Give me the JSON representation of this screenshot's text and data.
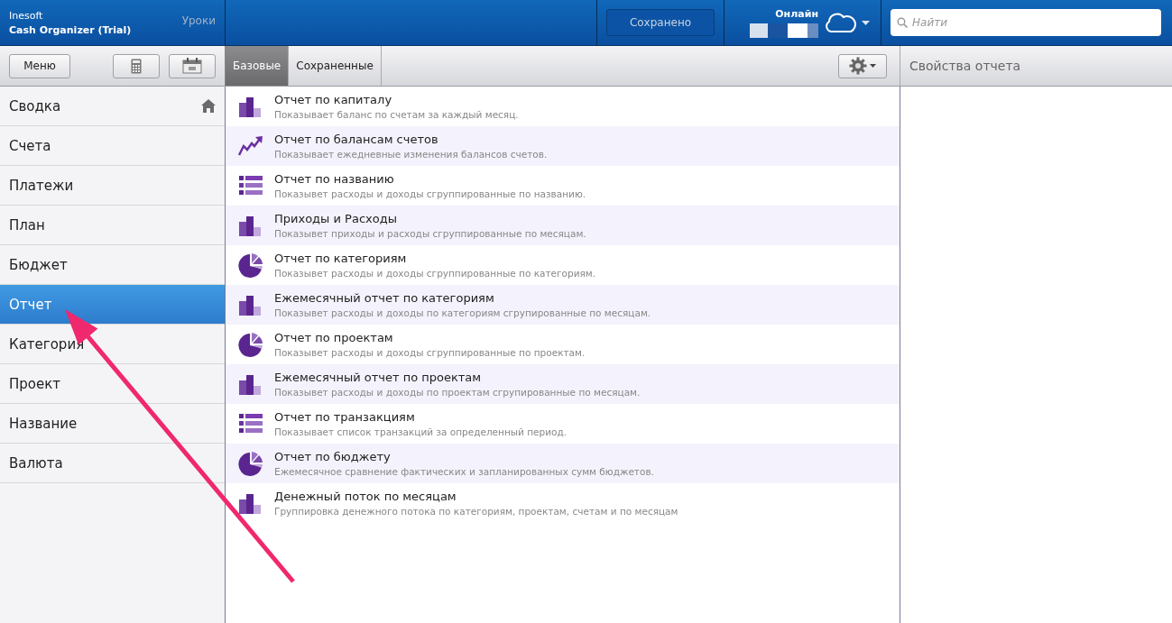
{
  "app": {
    "vendor": "Inesoft",
    "title": "Cash Organizer (Trial)",
    "lessons_link": "Уроки"
  },
  "header": {
    "save_status": "Сохранено",
    "online_label": "Онлайн",
    "search": {
      "placeholder": "Найти"
    }
  },
  "toolbar": {
    "menu_button": "Меню",
    "tabs": [
      {
        "label": "Базовые",
        "selected": true
      },
      {
        "label": "Сохраненные",
        "selected": false
      }
    ]
  },
  "sidebar": {
    "items": [
      {
        "label": "Сводка",
        "selected": false,
        "home": true
      },
      {
        "label": "Счета",
        "selected": false
      },
      {
        "label": "Платежи",
        "selected": false
      },
      {
        "label": "План",
        "selected": false
      },
      {
        "label": "Бюджет",
        "selected": false
      },
      {
        "label": "Отчет",
        "selected": true
      },
      {
        "label": "Категория",
        "selected": false
      },
      {
        "label": "Проект",
        "selected": false
      },
      {
        "label": "Название",
        "selected": false
      },
      {
        "label": "Валюта",
        "selected": false
      }
    ]
  },
  "reports": [
    {
      "kind": "bar",
      "title": "Отчет по капиталу",
      "description": "Показывает баланс по счетам за каждый месяц."
    },
    {
      "kind": "trend",
      "title": "Отчет по балансам счетов",
      "description": "Показывает ежедневные изменения балансов счетов."
    },
    {
      "kind": "list",
      "title": "Отчет по названию",
      "description": "Показывет расходы и доходы сгруппированные по названию."
    },
    {
      "kind": "bar",
      "title": "Приходы и Расходы",
      "description": "Показывет приходы и расходы сгруппированные по месяцам."
    },
    {
      "kind": "pie",
      "title": "Отчет по категориям",
      "description": "Показывет расходы и доходы сгруппированные по категориям."
    },
    {
      "kind": "bar",
      "title": "Ежемесячный отчет по категориям",
      "description": "Показывет расходы и доходы по категориям сгрупированные по месяцам."
    },
    {
      "kind": "pie",
      "title": "Отчет по проектам",
      "description": "Показывет расходы и доходы сгруппированные по проектам."
    },
    {
      "kind": "bar",
      "title": "Ежемесячный отчет по проектам",
      "description": "Показывет расходы и доходы по проектам сгрупированные по месяцам."
    },
    {
      "kind": "list",
      "title": "Отчет по транзакциям",
      "description": "Показывает список транзакций за определенный период."
    },
    {
      "kind": "pie",
      "title": "Отчет по бюджету",
      "description": "Ежемесячное сравнение фактических и запланированных сумм бюджетов."
    },
    {
      "kind": "bar",
      "title": "Денежный поток по месяцам",
      "description": "Группировка денежного потока по категориям, проектам, счетам и по месяцам"
    }
  ],
  "properties_panel": {
    "title": "Свойства отчета"
  }
}
